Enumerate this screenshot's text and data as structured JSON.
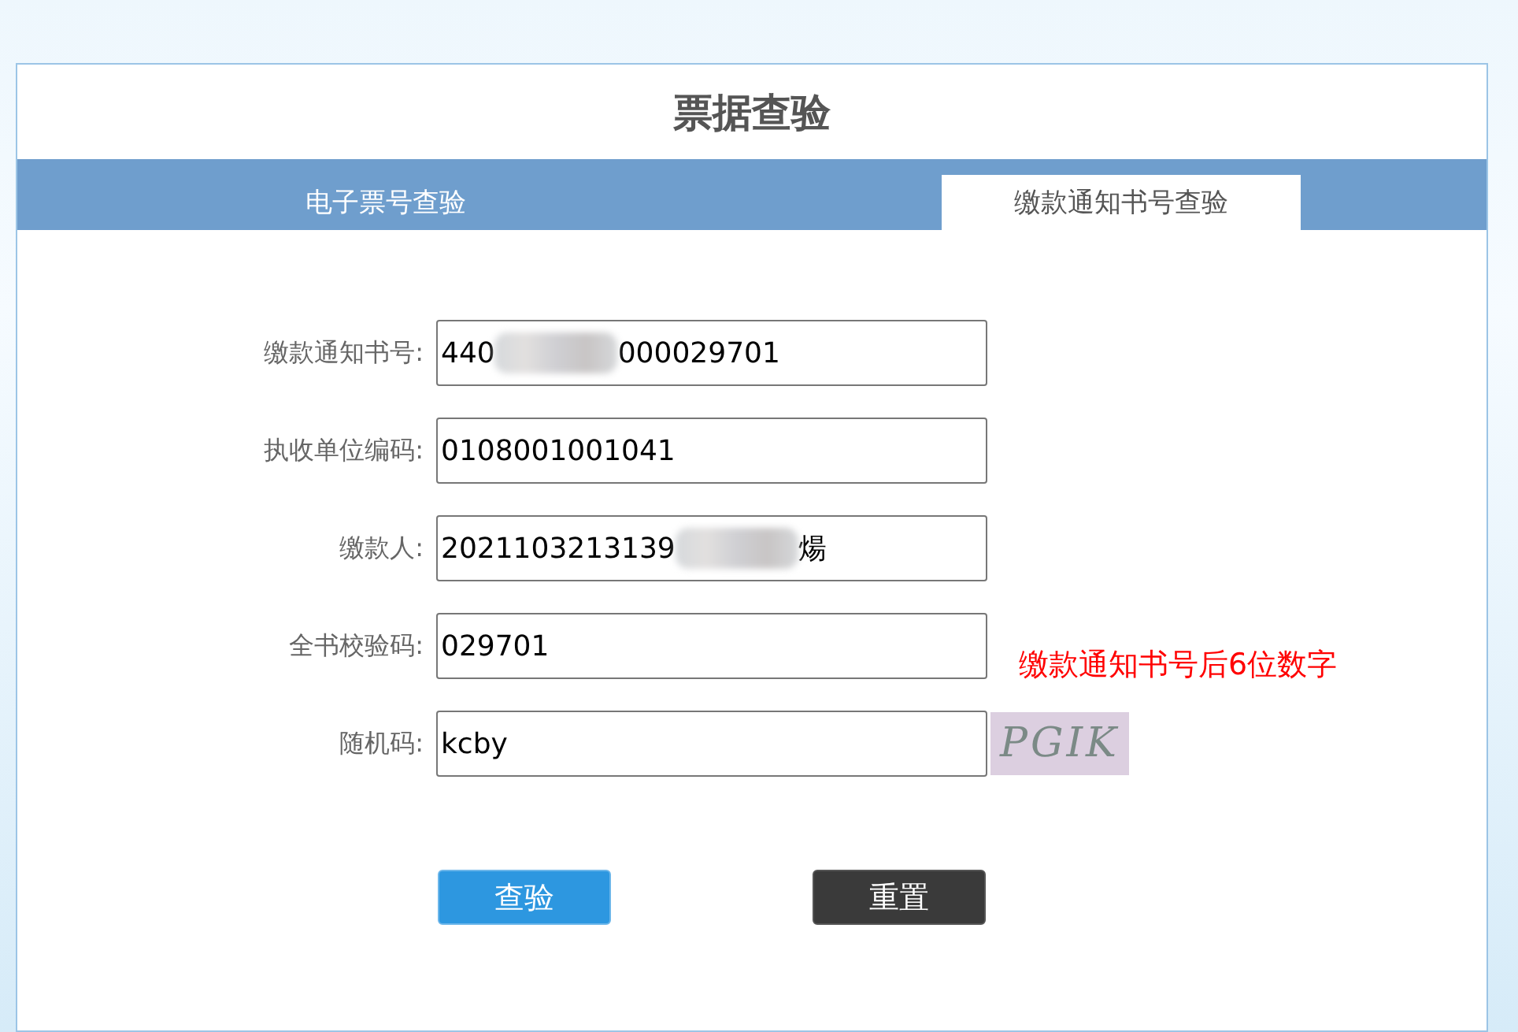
{
  "title": "票据查验",
  "tabs": [
    {
      "label": "电子票号查验",
      "selected": false
    },
    {
      "label": "缴款通知书号查验",
      "selected": true
    }
  ],
  "fields": [
    {
      "label": "缴款通知书号:",
      "value_start": "440",
      "redacted": true,
      "value_end": "000029701"
    },
    {
      "label": "执收单位编码:",
      "value_start": "0108001001041",
      "redacted": false
    },
    {
      "label": "缴款人:",
      "value_start": "2021103213139",
      "redacted": true,
      "value_end": "煬"
    },
    {
      "label": "全书校验码:",
      "value_start": "029701",
      "redacted": false,
      "hint": "缴款通知书号后6位数字"
    },
    {
      "label": "随机码:",
      "value_start": "kcby",
      "redacted": false,
      "captcha": "PGIK"
    }
  ],
  "buttons": [
    {
      "label": "查验",
      "kind": "primary"
    },
    {
      "label": "重置",
      "kind": "secondary"
    }
  ]
}
